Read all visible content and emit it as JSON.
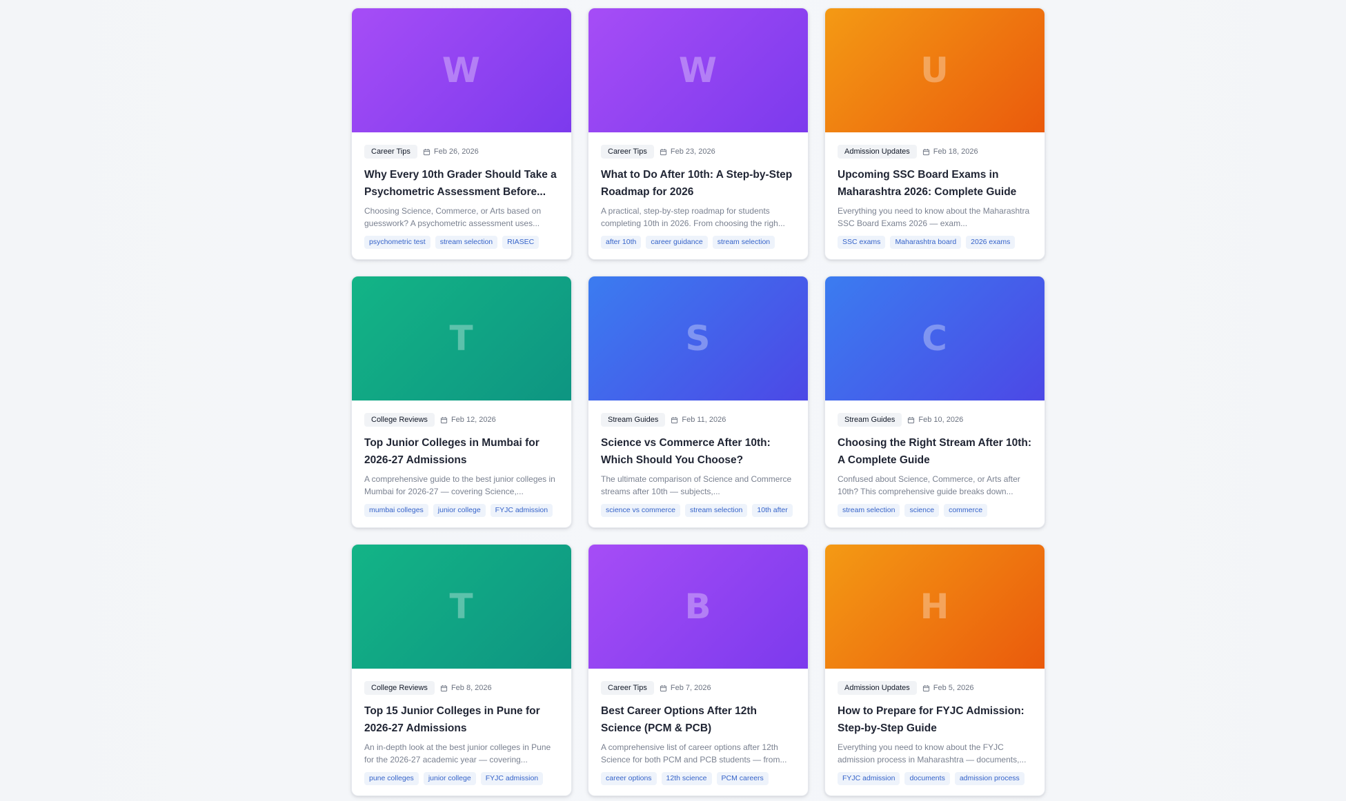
{
  "posts": [
    {
      "letter": "W",
      "color": "purple",
      "category": "Career Tips",
      "date": "Feb 26, 2026",
      "title": "Why Every 10th Grader Should Take a Psychometric Assessment Before...",
      "excerpt": "Choosing Science, Commerce, or Arts based on guesswork? A psychometric assessment uses...",
      "tags": [
        "psychometric test",
        "stream selection",
        "RIASEC"
      ]
    },
    {
      "letter": "W",
      "color": "purple",
      "category": "Career Tips",
      "date": "Feb 23, 2026",
      "title": "What to Do After 10th: A Step-by-Step Roadmap for 2026",
      "excerpt": "A practical, step-by-step roadmap for students completing 10th in 2026. From choosing the righ...",
      "tags": [
        "after 10th",
        "career guidance",
        "stream selection"
      ]
    },
    {
      "letter": "U",
      "color": "orange",
      "category": "Admission Updates",
      "date": "Feb 18, 2026",
      "title": "Upcoming SSC Board Exams in Maharashtra 2026: Complete Guide",
      "excerpt": "Everything you need to know about the Maharashtra SSC Board Exams 2026 — exam...",
      "tags": [
        "SSC exams",
        "Maharashtra board",
        "2026 exams"
      ]
    },
    {
      "letter": "T",
      "color": "green",
      "category": "College Reviews",
      "date": "Feb 12, 2026",
      "title": "Top Junior Colleges in Mumbai for 2026-27 Admissions",
      "excerpt": "A comprehensive guide to the best junior colleges in Mumbai for 2026-27 — covering Science,...",
      "tags": [
        "mumbai colleges",
        "junior college",
        "FYJC admission"
      ]
    },
    {
      "letter": "S",
      "color": "blue",
      "category": "Stream Guides",
      "date": "Feb 11, 2026",
      "title": "Science vs Commerce After 10th: Which Should You Choose?",
      "excerpt": "The ultimate comparison of Science and Commerce streams after 10th — subjects,...",
      "tags": [
        "science vs commerce",
        "stream selection",
        "10th after"
      ]
    },
    {
      "letter": "C",
      "color": "blue",
      "category": "Stream Guides",
      "date": "Feb 10, 2026",
      "title": "Choosing the Right Stream After 10th: A Complete Guide",
      "excerpt": "Confused about Science, Commerce, or Arts after 10th? This comprehensive guide breaks down...",
      "tags": [
        "stream selection",
        "science",
        "commerce"
      ]
    },
    {
      "letter": "T",
      "color": "green",
      "category": "College Reviews",
      "date": "Feb 8, 2026",
      "title": "Top 15 Junior Colleges in Pune for 2026-27 Admissions",
      "excerpt": "An in-depth look at the best junior colleges in Pune for the 2026-27 academic year — covering...",
      "tags": [
        "pune colleges",
        "junior college",
        "FYJC admission"
      ]
    },
    {
      "letter": "B",
      "color": "purple",
      "category": "Career Tips",
      "date": "Feb 7, 2026",
      "title": "Best Career Options After 12th Science (PCM & PCB)",
      "excerpt": "A comprehensive list of career options after 12th Science for both PCM and PCB students — from...",
      "tags": [
        "career options",
        "12th science",
        "PCM careers"
      ]
    },
    {
      "letter": "H",
      "color": "orange",
      "category": "Admission Updates",
      "date": "Feb 5, 2026",
      "title": "How to Prepare for FYJC Admission: Step-by-Step Guide",
      "excerpt": "Everything you need to know about the FYJC admission process in Maharashtra — documents,...",
      "tags": [
        "FYJC admission",
        "documents",
        "admission process"
      ]
    }
  ]
}
